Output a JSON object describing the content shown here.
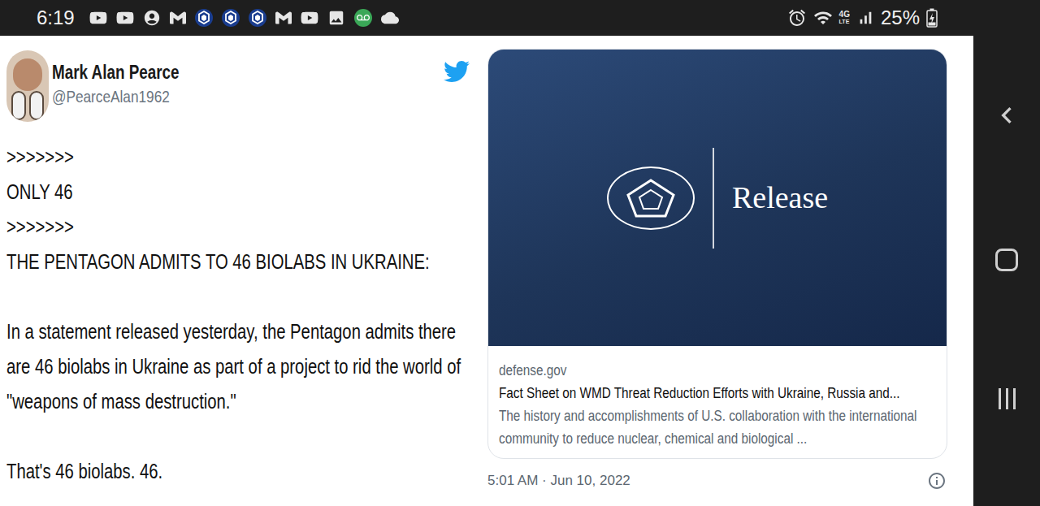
{
  "status_bar": {
    "time": "6:19",
    "network": "4G",
    "network_sub": "LTE",
    "battery": "25%",
    "battery_level": 0.25,
    "charging": true
  },
  "tweet": {
    "author": "Mark Alan Pearce",
    "handle": "@PearceAlan1962",
    "body": [
      {
        "lines": [
          ">>>>>>>",
          "ONLY 46",
          ">>>>>>>",
          "THE PENTAGON ADMITS TO 46 BIOLABS IN UKRAINE:"
        ]
      },
      {
        "lines": [
          "In a statement released yesterday, the Pentagon admits there are 46 biolabs in Ukraine as part of a project to rid the world of \"weapons of mass destruction.\""
        ]
      },
      {
        "lines": [
          "That's 46 biolabs. 46."
        ]
      }
    ]
  },
  "card": {
    "image_label": "Release",
    "domain": "defense.gov",
    "title": "Fact Sheet on WMD Threat Reduction Efforts with Ukraine, Russia and...",
    "description": "The history and accomplishments of U.S. collaboration with the international community to reduce nuclear, chemical and biological ..."
  },
  "timestamp": "5:01 AM · Jun 10, 2022"
}
